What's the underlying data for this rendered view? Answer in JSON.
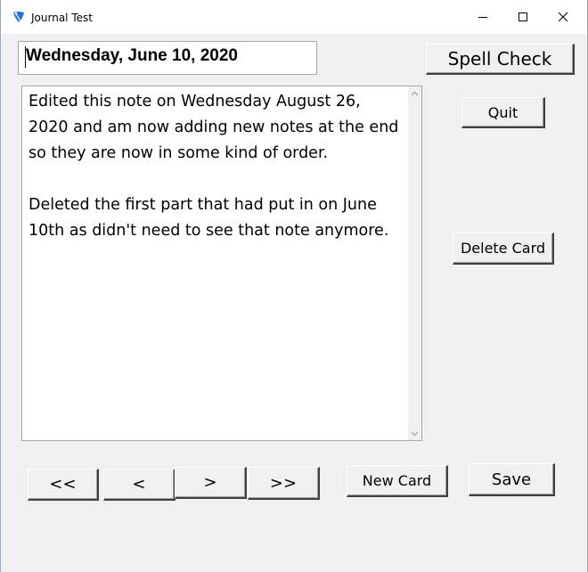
{
  "window": {
    "title": "Journal Test",
    "controls": {
      "minimize_icon": "minimize-icon",
      "maximize_icon": "maximize-icon",
      "close_icon": "close-icon"
    }
  },
  "journal": {
    "date": "Wednesday, June 10, 2020",
    "entry_paragraphs": [
      "Edited this note on Wednesday August 26, 2020 and am now adding new notes at the end so they are now in some kind of order.",
      "Deleted the first part that had put in on June 10th as didn't need to see that note anymore."
    ]
  },
  "buttons": {
    "spell_check": "Spell Check",
    "quit": "Quit",
    "delete_card": "Delete Card",
    "first": "<<",
    "previous": "<",
    "next": ">",
    "last": ">>",
    "new_card": "New Card",
    "save": "Save"
  },
  "colors": {
    "window_bg": "#f0f0f0",
    "titlebar_bg": "#ffffff",
    "app_icon_blue": "#1e6fd9"
  }
}
